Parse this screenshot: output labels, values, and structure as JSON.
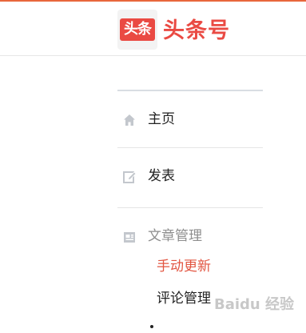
{
  "header": {
    "logo_badge_text": "头条",
    "logo_text": "头条号"
  },
  "nav": {
    "items": [
      {
        "label": "主页",
        "icon": "home-icon"
      },
      {
        "label": "发表",
        "icon": "edit-icon"
      },
      {
        "label": "文章管理",
        "icon": "article-icon"
      }
    ],
    "sub_items": [
      {
        "label": "手动更新",
        "active": true
      },
      {
        "label": "评论管理",
        "active": false
      }
    ]
  },
  "watermark": {
    "text": "Baidu 经验"
  },
  "colors": {
    "brand": "#ea4a43",
    "active": "#e25541",
    "top_accent": "#e8673c"
  }
}
